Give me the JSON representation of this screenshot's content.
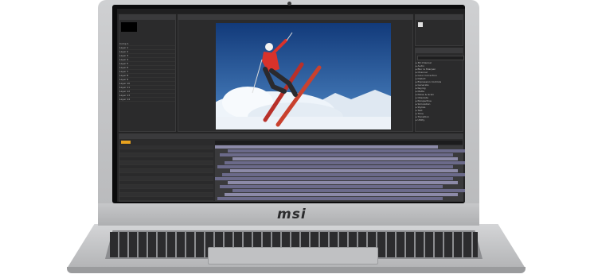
{
  "brand": {
    "logo_text": "msi"
  },
  "app": {
    "project_panel": {
      "items": [
        "Comp 1",
        "Layer 1",
        "Layer 2",
        "Layer 3",
        "Layer 4",
        "Layer 5",
        "Layer 6",
        "Layer 7",
        "Layer 8",
        "Layer 9",
        "Layer 10",
        "Layer 11",
        "Layer 12",
        "Layer 13",
        "Layer 14"
      ]
    },
    "effects_panel": {
      "items": [
        "3D Channel",
        "Audio",
        "Blur & Sharpen",
        "Channel",
        "Color Correction",
        "Distort",
        "Expression Controls",
        "Generate",
        "Keying",
        "Matte",
        "Noise & Grain",
        "Obsolete",
        "Perspective",
        "Simulation",
        "Stylize",
        "Text",
        "Time",
        "Transition",
        "Utility"
      ]
    },
    "timeline": {
      "rows": 14
    }
  },
  "preview": {
    "scene": "skier-jump",
    "colors": {
      "sky": "#1e4f9c",
      "jacket": "#d9322b",
      "snow": "#e8f0f8",
      "skis": "#c23a2a"
    }
  }
}
